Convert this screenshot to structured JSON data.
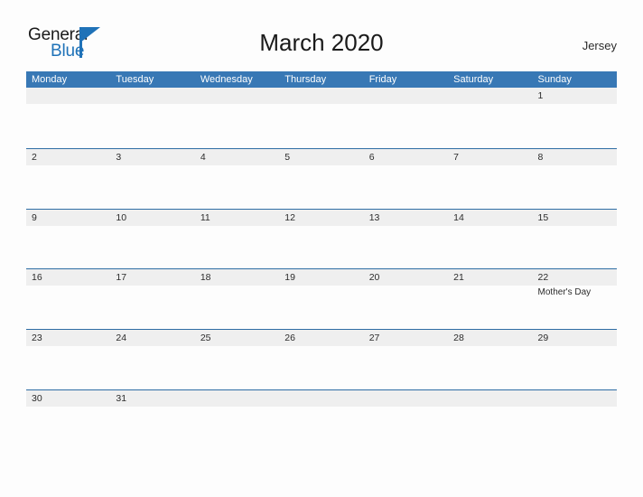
{
  "brand": {
    "name_part1": "General",
    "name_part2": "Blue",
    "triangle_icon": "triangle-icon",
    "accent_color": "#1f72b8"
  },
  "header": {
    "title": "March 2020",
    "locale": "Jersey"
  },
  "theme": {
    "header_blue": "#3878b5",
    "rule_blue": "#2e6da4",
    "band_gray": "#efefef",
    "page_background": "#fdfdfd",
    "text_color": "#2b2b2b"
  },
  "calendar": {
    "month": "March",
    "year": "2020",
    "weekday_headers": [
      "Monday",
      "Tuesday",
      "Wednesday",
      "Thursday",
      "Friday",
      "Saturday",
      "Sunday"
    ],
    "weeks": [
      {
        "days": [
          {
            "num": "",
            "event": ""
          },
          {
            "num": "",
            "event": ""
          },
          {
            "num": "",
            "event": ""
          },
          {
            "num": "",
            "event": ""
          },
          {
            "num": "",
            "event": ""
          },
          {
            "num": "",
            "event": ""
          },
          {
            "num": "1",
            "event": ""
          }
        ]
      },
      {
        "days": [
          {
            "num": "2",
            "event": ""
          },
          {
            "num": "3",
            "event": ""
          },
          {
            "num": "4",
            "event": ""
          },
          {
            "num": "5",
            "event": ""
          },
          {
            "num": "6",
            "event": ""
          },
          {
            "num": "7",
            "event": ""
          },
          {
            "num": "8",
            "event": ""
          }
        ]
      },
      {
        "days": [
          {
            "num": "9",
            "event": ""
          },
          {
            "num": "10",
            "event": ""
          },
          {
            "num": "11",
            "event": ""
          },
          {
            "num": "12",
            "event": ""
          },
          {
            "num": "13",
            "event": ""
          },
          {
            "num": "14",
            "event": ""
          },
          {
            "num": "15",
            "event": ""
          }
        ]
      },
      {
        "days": [
          {
            "num": "16",
            "event": ""
          },
          {
            "num": "17",
            "event": ""
          },
          {
            "num": "18",
            "event": ""
          },
          {
            "num": "19",
            "event": ""
          },
          {
            "num": "20",
            "event": ""
          },
          {
            "num": "21",
            "event": ""
          },
          {
            "num": "22",
            "event": "Mother's Day"
          }
        ]
      },
      {
        "days": [
          {
            "num": "23",
            "event": ""
          },
          {
            "num": "24",
            "event": ""
          },
          {
            "num": "25",
            "event": ""
          },
          {
            "num": "26",
            "event": ""
          },
          {
            "num": "27",
            "event": ""
          },
          {
            "num": "28",
            "event": ""
          },
          {
            "num": "29",
            "event": ""
          }
        ]
      },
      {
        "days": [
          {
            "num": "30",
            "event": ""
          },
          {
            "num": "31",
            "event": ""
          },
          {
            "num": "",
            "event": ""
          },
          {
            "num": "",
            "event": ""
          },
          {
            "num": "",
            "event": ""
          },
          {
            "num": "",
            "event": ""
          },
          {
            "num": "",
            "event": ""
          }
        ]
      }
    ]
  }
}
